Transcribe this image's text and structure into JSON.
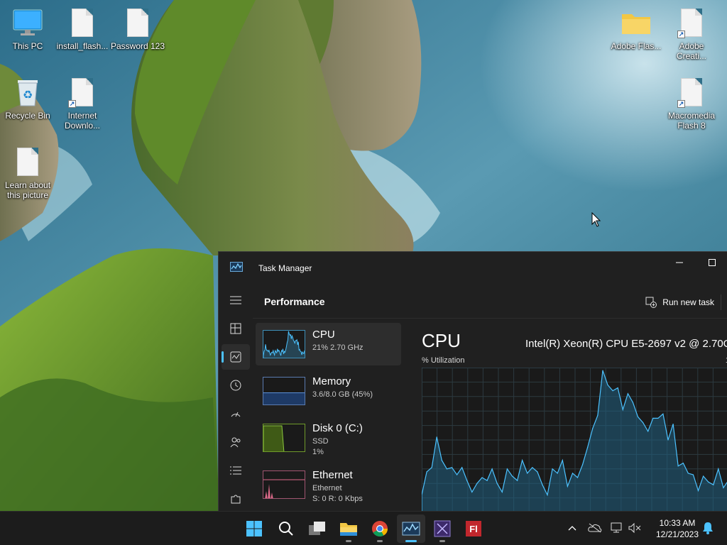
{
  "desktop": {
    "icons": [
      {
        "label": "This PC"
      },
      {
        "label": "install_flash..."
      },
      {
        "label": "Password 123"
      },
      {
        "label": "Recycle Bin"
      },
      {
        "label": "Internet Downlo..."
      },
      {
        "label": "Learn about this picture"
      },
      {
        "label": "Adobe Flas..."
      },
      {
        "label": "Adobe Creati..."
      },
      {
        "label": "Macromedia Flash 8"
      }
    ]
  },
  "task_manager": {
    "title": "Task Manager",
    "section_title": "Performance",
    "run_new_task": "Run new task",
    "nav_items": [
      "menu-icon",
      "processes-icon",
      "performance-icon",
      "app-history-icon",
      "startup-apps-icon",
      "users-icon",
      "details-icon",
      "services-icon"
    ],
    "resources": [
      {
        "name": "CPU",
        "line1": "21% 2.70 GHz",
        "line2": ""
      },
      {
        "name": "Memory",
        "line1": "3.6/8.0 GB (45%)",
        "line2": ""
      },
      {
        "name": "Disk 0 (C:)",
        "line1": "SSD",
        "line2": "1%"
      },
      {
        "name": "Ethernet",
        "line1": "Ethernet",
        "line2": "S: 0 R: 0 Kbps"
      }
    ],
    "cpu_panel": {
      "title": "CPU",
      "model": "Intel(R) Xeon(R) CPU E5-2697 v2 @ 2.70G",
      "util_label": "% Utilization",
      "util_max": "1"
    },
    "memory_fill_percent": 45,
    "colors": {
      "cpu": "#4cc2ff",
      "memory": "#5a8fd8",
      "disk": "#8cc63f",
      "ethernet": "#e06b8b",
      "accent": "#4cc2ff"
    }
  },
  "chart_data": {
    "type": "area",
    "series": [
      {
        "values": [
          12,
          28,
          31,
          52,
          36,
          30,
          31,
          26,
          31,
          22,
          14,
          20,
          24,
          22,
          30,
          20,
          14,
          30,
          25,
          22,
          36,
          27,
          31,
          28,
          19,
          12,
          30,
          27,
          36,
          18,
          27,
          24,
          33,
          45,
          58,
          67,
          98,
          88,
          84,
          86,
          71,
          82,
          76,
          66,
          62,
          56,
          65,
          65,
          68,
          50,
          61,
          32,
          34,
          27,
          26,
          15,
          25,
          21,
          19,
          30,
          17,
          22
        ]
      }
    ],
    "ylim": [
      0,
      100
    ]
  },
  "taskbar": {
    "apps": [
      "windows-start-icon",
      "search-icon",
      "task-view-icon",
      "file-explorer-icon",
      "chrome-icon",
      "task-manager-icon",
      "visual-studio-icon",
      "flash-icon"
    ],
    "clock_time": "10:33 AM",
    "clock_date": "12/21/2023"
  }
}
